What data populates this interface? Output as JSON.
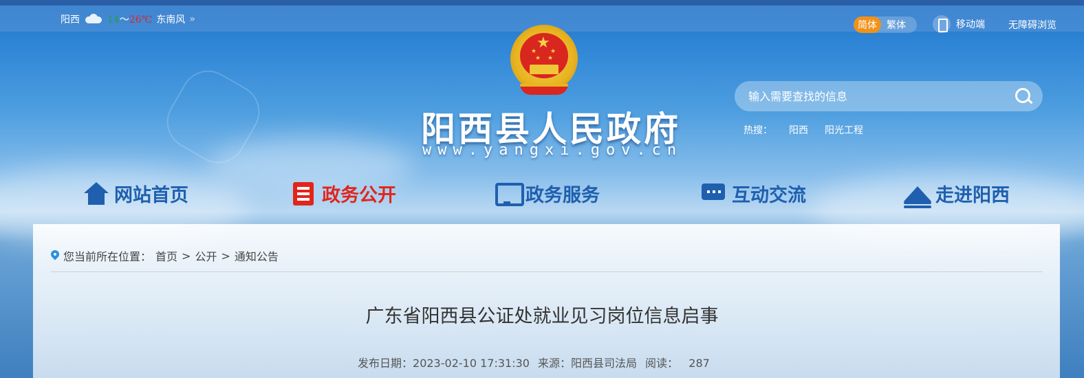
{
  "topbar": {
    "weather": {
      "city": "阳西",
      "temp_low": "14",
      "temp_sep": "～",
      "temp_high": "26℃",
      "wind": "东南风",
      "more": "»"
    },
    "lang": {
      "simplified": "简体",
      "traditional": "繁体"
    },
    "mobile": "移动端",
    "accessibility": "无障碍浏览"
  },
  "header": {
    "site_title": "阳西县人民政府",
    "site_url": "www.yangxi.gov.cn"
  },
  "search": {
    "placeholder": "输入需要查找的信息",
    "hot_label": "热搜：",
    "hot_terms": [
      "阳西",
      "阳光工程"
    ]
  },
  "nav": {
    "items": [
      {
        "label": "网站首页",
        "icon": "home-icon"
      },
      {
        "label": "政务公开",
        "icon": "open-icon",
        "active": true
      },
      {
        "label": "政务服务",
        "icon": "service-icon"
      },
      {
        "label": "互动交流",
        "icon": "chat-icon"
      },
      {
        "label": "走进阳西",
        "icon": "mountain-icon"
      }
    ]
  },
  "breadcrumb": {
    "label": "您当前所在位置：",
    "items": [
      "首页",
      "公开",
      "通知公告"
    ],
    "sep": ">"
  },
  "article": {
    "title": "广东省阳西县公证处就业见习岗位信息启事",
    "date_label": "发布日期：",
    "date": "2023-02-10 17:31:30",
    "source_label": "来源：",
    "source": "阳西县司法局",
    "reads_label": "阅读：",
    "reads": "287"
  },
  "colors": {
    "nav_text": "#1f5fae",
    "nav_active": "#e1251b",
    "lang_active_bg": "#f19218"
  }
}
